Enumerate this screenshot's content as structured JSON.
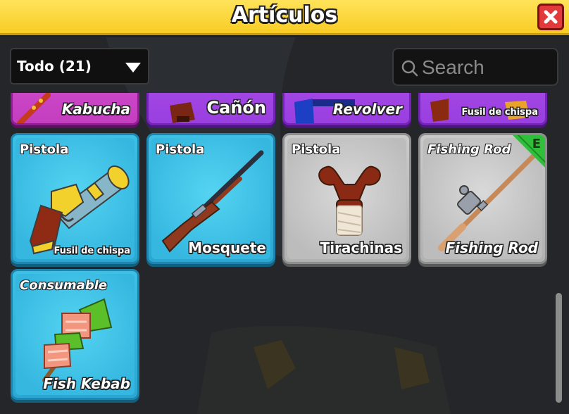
{
  "window": {
    "title": "Artículos",
    "close_icon": "close-icon"
  },
  "filter": {
    "selected": "Todo (21)"
  },
  "search": {
    "placeholder": "Search",
    "value": ""
  },
  "partial_row": [
    {
      "name": "Kabucha",
      "rarity": "pink"
    },
    {
      "name": "Cañón",
      "rarity": "purple"
    },
    {
      "name": "Revolver",
      "rarity": "purple"
    },
    {
      "name": "Fusil de chispa",
      "rarity": "purple"
    }
  ],
  "items": [
    {
      "category": "Pistola",
      "name": "Fusil de chispa",
      "rarity": "blue",
      "icon": "flintlock-pistol-icon"
    },
    {
      "category": "Pistola",
      "name": "Mosquete",
      "rarity": "blue",
      "icon": "musket-icon"
    },
    {
      "category": "Pistola",
      "name": "Tirachinas",
      "rarity": "gray",
      "icon": "slingshot-icon"
    },
    {
      "category": "Fishing Rod",
      "name": "Fishing Rod",
      "rarity": "gray",
      "icon": "fishing-rod-icon",
      "equipped": "E"
    },
    {
      "category": "Consumable",
      "name": "Fish Kebab",
      "rarity": "blue",
      "icon": "fish-kebab-icon"
    }
  ],
  "colors": {
    "title_bar": "#f8cc24",
    "close_button": "#e23a3a",
    "rarity_blue": "#2aa7d2",
    "rarity_gray": "#b1b1b1",
    "rarity_purple": "#9a3fe0",
    "rarity_pink": "#c33fc0",
    "equipped_badge": "#2fbf3a"
  }
}
